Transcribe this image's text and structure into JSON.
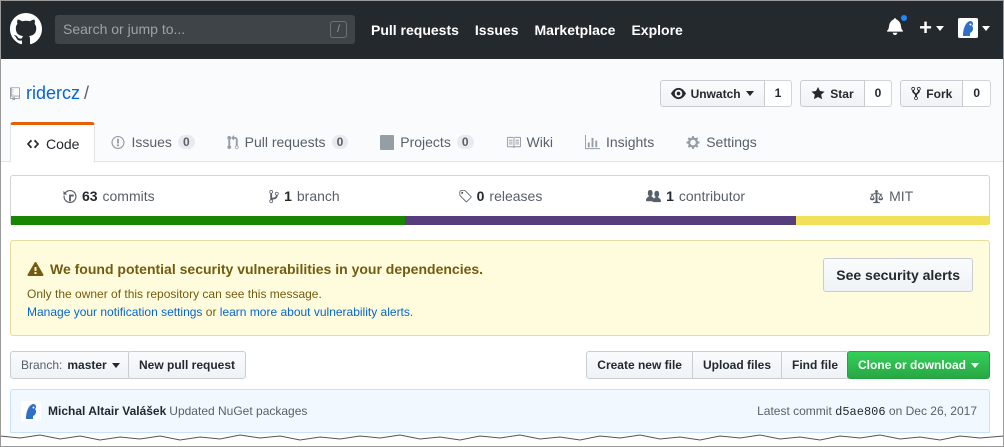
{
  "header": {
    "search_placeholder": "Search or jump to...",
    "search_shortcut": "/",
    "nav": [
      "Pull requests",
      "Issues",
      "Marketplace",
      "Explore"
    ],
    "plus_label": "+"
  },
  "repo": {
    "owner": "ridercz",
    "separator": "/",
    "watch": {
      "label": "Unwatch",
      "count": "1"
    },
    "star": {
      "label": "Star",
      "count": "0"
    },
    "fork": {
      "label": "Fork",
      "count": "0"
    },
    "tabs": [
      {
        "label": "Code"
      },
      {
        "label": "Issues",
        "count": "0"
      },
      {
        "label": "Pull requests",
        "count": "0"
      },
      {
        "label": "Projects",
        "count": "0"
      },
      {
        "label": "Wiki"
      },
      {
        "label": "Insights"
      },
      {
        "label": "Settings"
      }
    ]
  },
  "summary": {
    "commits": {
      "num": "63",
      "label": "commits"
    },
    "branches": {
      "num": "1",
      "label": "branch"
    },
    "releases": {
      "num": "0",
      "label": "releases"
    },
    "contributors": {
      "num": "1",
      "label": "contributor"
    },
    "license": "MIT",
    "language_colors": [
      "#178600",
      "#563d7c",
      "#f1e05a"
    ],
    "language_fractions": [
      0.403,
      0.4,
      0.197
    ]
  },
  "alert": {
    "title": "We found potential security vulnerabilities in your dependencies.",
    "subtitle": "Only the owner of this repository can see this message.",
    "link1": "Manage your notification settings",
    "or": "or",
    "link2": "learn more about vulnerability alerts",
    "period": ".",
    "button": "See security alerts"
  },
  "filenav": {
    "branch_prefix": "Branch:",
    "branch": "master",
    "new_pr": "New pull request",
    "create_file": "Create new file",
    "upload": "Upload files",
    "find": "Find file",
    "clone": "Clone or download"
  },
  "commit": {
    "author": "Michal Altair Valášek",
    "message": "Updated NuGet packages",
    "latest_label": "Latest commit",
    "sha": "d5ae806",
    "on": "on",
    "date": "Dec 26, 2017"
  }
}
